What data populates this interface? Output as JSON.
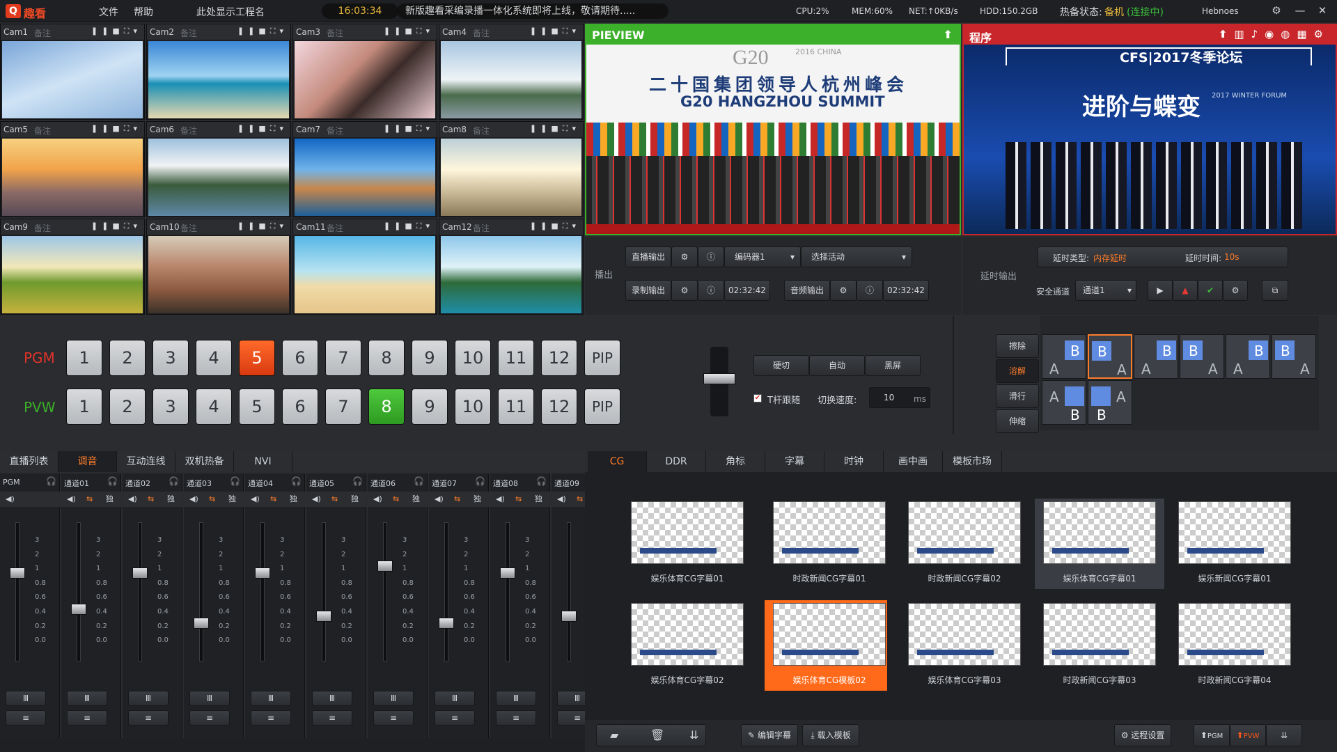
{
  "app": {
    "logo_letter": "Q",
    "logo_name": "趣看"
  },
  "menu": {
    "file": "文件",
    "help": "帮助",
    "project": "此处显示工程名"
  },
  "clock": "16:03:34",
  "news": "新版趣看采编录播一体化系统即将上线，敬请期待.....",
  "stats": {
    "cpu": "CPU:2%",
    "mem": "MEM:60%",
    "net": "NET:↑0KB/s",
    "hdd": "HDD:150.2GB",
    "backup_label": "热备状态:",
    "backup_mode": "备机",
    "backup_state": "(连接中)",
    "user": "Hebnoes"
  },
  "cameras": [
    {
      "name": "Cam1",
      "note": "备注"
    },
    {
      "name": "Cam2",
      "note": "备注"
    },
    {
      "name": "Cam3",
      "note": "备注"
    },
    {
      "name": "Cam4",
      "note": "备注"
    },
    {
      "name": "Cam5",
      "note": "备注"
    },
    {
      "name": "Cam6",
      "note": "备注"
    },
    {
      "name": "Cam7",
      "note": "备注"
    },
    {
      "name": "Cam8",
      "note": "备注"
    },
    {
      "name": "Cam9",
      "note": "备注"
    },
    {
      "name": "Cam10",
      "note": "备注"
    },
    {
      "name": "Cam11",
      "note": "备注"
    },
    {
      "name": "Cam12",
      "note": "备注"
    }
  ],
  "preview": {
    "title": "PIEVIEW",
    "headline_cn": "二十国集团领导人杭州峰会",
    "headline_en": "G20 HANGZHOU SUMMIT",
    "logo": "G20",
    "logo_sub": "2016 CHINA"
  },
  "program": {
    "title": "程序",
    "banner": "CFS|2017冬季论坛",
    "slogan": "进阶与蝶变",
    "slogan_sub": "2017 WINTER FORUM"
  },
  "output": {
    "section": "播出",
    "live": "直播输出",
    "encoder": "编码器1",
    "activity": "选择活动",
    "record": "录制输出",
    "record_time": "02:32:42",
    "audio": "音频输出",
    "audio_time": "02:32:42"
  },
  "delay": {
    "section": "延时输出",
    "type_label": "延时类型:",
    "type_value": "内存延时",
    "time_label": "延时时间:",
    "time_value": "10s",
    "safe_label": "安全通道",
    "channel": "通道1"
  },
  "switcher": {
    "pgm": "PGM",
    "pvw": "PVW",
    "buttons": [
      "1",
      "2",
      "3",
      "4",
      "5",
      "6",
      "7",
      "8",
      "9",
      "10",
      "11",
      "12",
      "PIP"
    ],
    "pgm_active": "5",
    "pvw_active": "8"
  },
  "transition": {
    "hard_cut": "硬切",
    "auto": "自动",
    "black": "黑屏",
    "tbar_follow": "T杆跟随",
    "speed_label": "切换速度:",
    "speed": "10",
    "unit": "ms",
    "types": [
      "擦除",
      "溶解",
      "滑行",
      "伸缩"
    ]
  },
  "mixer_tabs": [
    "直播列表",
    "调音",
    "互动连线",
    "双机热备",
    "NVI"
  ],
  "channels": [
    "PGM",
    "通道01",
    "通道02",
    "通道03",
    "通道04",
    "通道05",
    "通道06",
    "通道07",
    "通道08",
    "通道09"
  ],
  "scale": [
    "3",
    "2",
    "1",
    "0.8",
    "0.6",
    "0.4",
    "0.2",
    "0.0"
  ],
  "cg_tabs": [
    "CG",
    "DDR",
    "角标",
    "字幕",
    "时钟",
    "画中画",
    "模板市场"
  ],
  "cg_items": [
    "娱乐体育CG字幕01",
    "时政新闻CG字幕01",
    "时政新闻CG字幕02",
    "娱乐体育CG字幕01",
    "娱乐新闻CG字幕01",
    "娱乐体育CG字幕02",
    "娱乐体育CG模板02",
    "娱乐体育CG字幕03",
    "时政新闻CG字幕03",
    "时政新闻CG字幕04"
  ],
  "cg_bottom": {
    "edit": "编辑字幕",
    "load": "载入模板",
    "remote": "远程设置",
    "pgm": "PGM",
    "pvw": "PVW"
  },
  "colors": {
    "accent": "#ff7d2a",
    "pvw_green": "#3cb02a",
    "pgm_red": "#e0332a"
  }
}
